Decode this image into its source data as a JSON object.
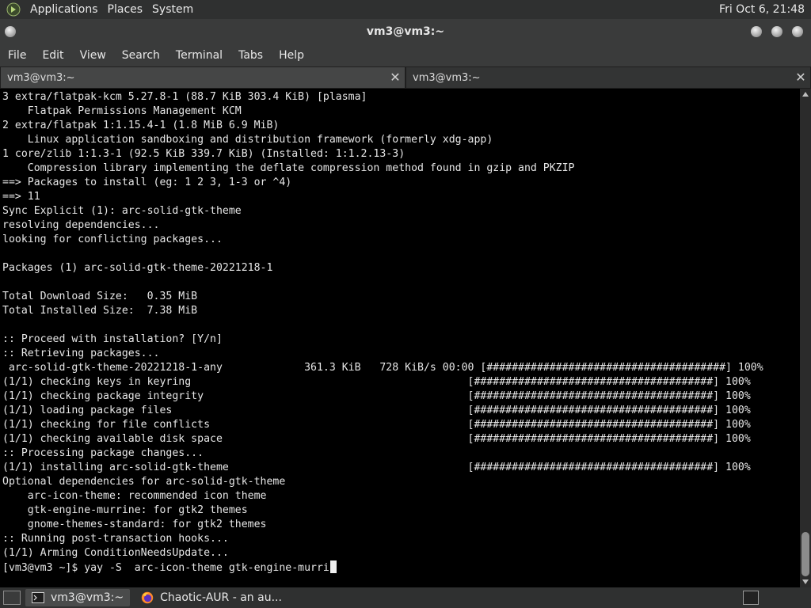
{
  "top_panel": {
    "menus": [
      "Applications",
      "Places",
      "System"
    ],
    "clock": "Fri Oct 6, 21:48"
  },
  "window": {
    "title": "vm3@vm3:~"
  },
  "menubar": [
    "File",
    "Edit",
    "View",
    "Search",
    "Terminal",
    "Tabs",
    "Help"
  ],
  "tabs": [
    {
      "label": "vm3@vm3:~"
    },
    {
      "label": "vm3@vm3:~"
    }
  ],
  "terminal": {
    "lines": [
      "3 extra/flatpak-kcm 5.27.8-1 (88.7 KiB 303.4 KiB) [plasma]",
      "    Flatpak Permissions Management KCM",
      "2 extra/flatpak 1:1.15.4-1 (1.8 MiB 6.9 MiB)",
      "    Linux application sandboxing and distribution framework (formerly xdg-app)",
      "1 core/zlib 1:1.3-1 (92.5 KiB 339.7 KiB) (Installed: 1:1.2.13-3)",
      "    Compression library implementing the deflate compression method found in gzip and PKZIP",
      "==> Packages to install (eg: 1 2 3, 1-3 or ^4)",
      "==> 11",
      "Sync Explicit (1): arc-solid-gtk-theme",
      "resolving dependencies...",
      "looking for conflicting packages...",
      "",
      "Packages (1) arc-solid-gtk-theme-20221218-1",
      "",
      "Total Download Size:   0.35 MiB",
      "Total Installed Size:  7.38 MiB",
      "",
      ":: Proceed with installation? [Y/n]",
      ":: Retrieving packages...",
      " arc-solid-gtk-theme-20221218-1-any             361.3 KiB   728 KiB/s 00:00 [######################################] 100%",
      "(1/1) checking keys in keyring                                            [######################################] 100%",
      "(1/1) checking package integrity                                          [######################################] 100%",
      "(1/1) loading package files                                               [######################################] 100%",
      "(1/1) checking for file conflicts                                         [######################################] 100%",
      "(1/1) checking available disk space                                       [######################################] 100%",
      ":: Processing package changes...",
      "(1/1) installing arc-solid-gtk-theme                                      [######################################] 100%",
      "Optional dependencies for arc-solid-gtk-theme",
      "    arc-icon-theme: recommended icon theme",
      "    gtk-engine-murrine: for gtk2 themes",
      "    gnome-themes-standard: for gtk2 themes",
      ":: Running post-transaction hooks...",
      "(1/1) Arming ConditionNeedsUpdate..."
    ],
    "prompt": "[vm3@vm3 ~]$ yay -S  arc-icon-theme gtk-engine-murri"
  },
  "taskbar": {
    "items": [
      {
        "label": "vm3@vm3:~"
      },
      {
        "label": "Chaotic-AUR - an au..."
      }
    ]
  },
  "colors": {
    "terminal_bg": "#000000",
    "terminal_fg": "#e6e6e6",
    "panel_bg": "#2f3030"
  }
}
